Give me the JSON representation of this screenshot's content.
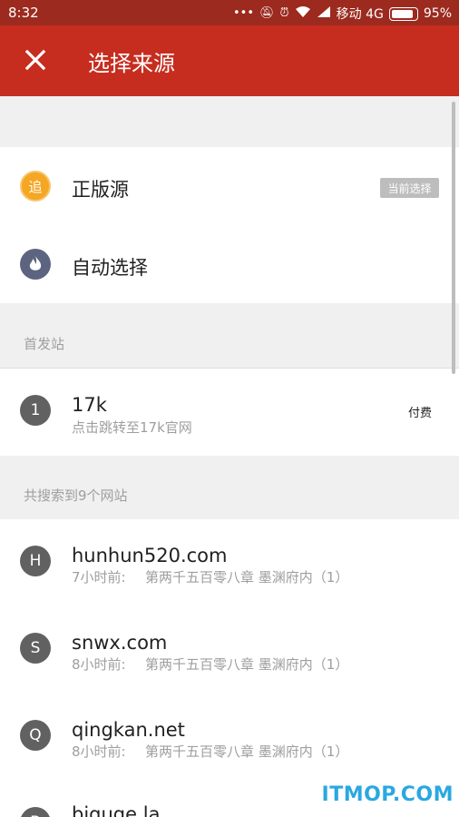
{
  "status_bar": {
    "time": "8:32",
    "carrier": "移动 4G",
    "battery": "95%",
    "icons": [
      "more-dots-icon",
      "mute-icon",
      "alarm-icon",
      "wifi-icon",
      "signal-icon",
      "battery-icon"
    ]
  },
  "app_bar": {
    "title": "选择来源",
    "close_icon": "close-icon",
    "color": "#c62d1f"
  },
  "sources": [
    {
      "label": "正版源",
      "icon": "追",
      "icon_color": "#f5a623",
      "badge": "当前选择"
    },
    {
      "label": "自动选择",
      "icon": "flame-icon",
      "icon_color": "#5c6480"
    }
  ],
  "first_site_section": {
    "label": "首发站",
    "item": {
      "index": "1",
      "name": "17k",
      "subtitle": "点击跳转至17k官网",
      "tag": "付费"
    }
  },
  "search_section": {
    "label": "共搜索到9个网站",
    "items": [
      {
        "letter": "H",
        "name": "hunhun520.com",
        "time": "7小时前:",
        "chapter": "第两千五百零八章 墨渊府内（1）"
      },
      {
        "letter": "S",
        "name": "snwx.com",
        "time": "8小时前:",
        "chapter": "第两千五百零八章 墨渊府内（1）"
      },
      {
        "letter": "Q",
        "name": "qingkan.net",
        "time": "8小时前:",
        "chapter": "第两千五百零八章 墨渊府内（1）"
      },
      {
        "letter": "B",
        "name": "biquge.la",
        "time": "",
        "chapter": ""
      }
    ]
  },
  "watermark": "ITMOP.COM"
}
